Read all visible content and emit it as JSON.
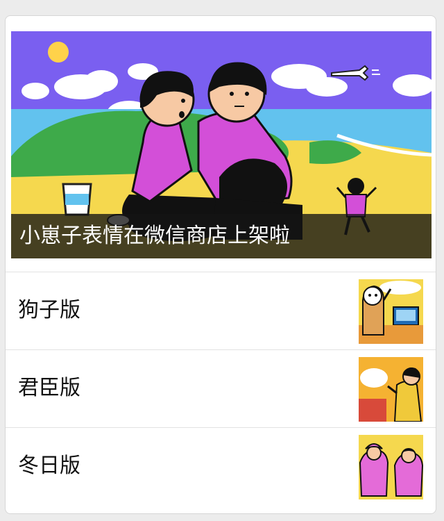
{
  "cover": {
    "title": "小崽子表情在微信商店上架啦",
    "image": "beach-hug-illustration"
  },
  "items": [
    {
      "label": "狗子版",
      "thumb": "dog-office-illustration"
    },
    {
      "label": "君臣版",
      "thumb": "court-scene-illustration"
    },
    {
      "label": "冬日版",
      "thumb": "winter-jackets-illustration"
    }
  ],
  "colors": {
    "sky": "#7a5ff0",
    "sea": "#62c2ee",
    "sand": "#f5d84e",
    "grass": "#3eaa4a",
    "sweater": "#d34fd8",
    "caption_bg": "#141414"
  }
}
